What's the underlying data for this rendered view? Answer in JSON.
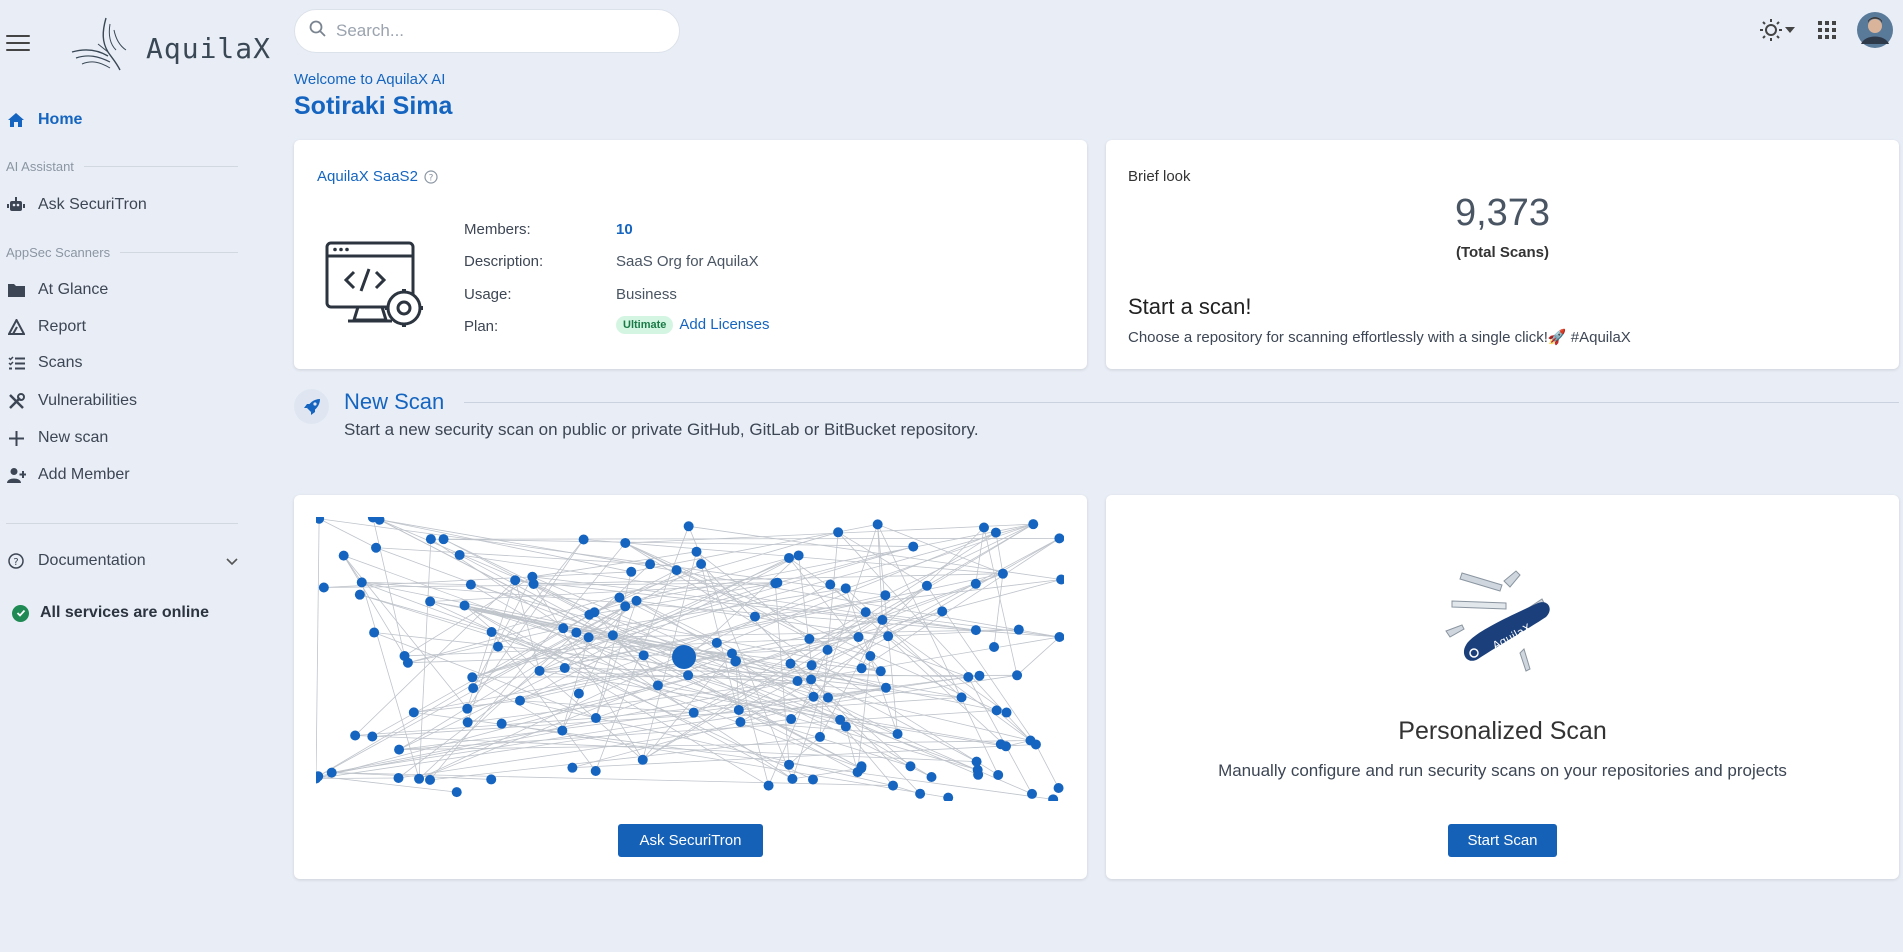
{
  "sidebar": {
    "logo_text": "AquilaX",
    "home": "Home",
    "section_ai": "AI Assistant",
    "ask": "Ask SecuriTron",
    "section_appsec": "AppSec Scanners",
    "items": [
      "At Glance",
      "Report",
      "Scans",
      "Vulnerabilities",
      "New scan",
      "Add Member"
    ],
    "documentation": "Documentation",
    "status": "All services are online"
  },
  "search": {
    "placeholder": "Search..."
  },
  "header": {
    "welcome": "Welcome to AquilaX AI",
    "user": "Sotiraki Sima"
  },
  "org": {
    "title": "AquilaX SaaS2",
    "members_label": "Members:",
    "members_value": "10",
    "description_label": "Description:",
    "description_value": "SaaS Org for AquilaX",
    "usage_label": "Usage:",
    "usage_value": "Business",
    "plan_label": "Plan:",
    "plan_badge": "Ultimate",
    "add_licenses": "Add Licenses"
  },
  "brief": {
    "title": "Brief look",
    "total": "9,373",
    "total_label": "(Total Scans)",
    "start_title": "Start a scan!",
    "start_sub": "Choose a repository for scanning effortlessly with a single click!🚀 #AquilaX"
  },
  "new_scan": {
    "title": "New Scan",
    "subtitle": "Start a new security scan on public or private GitHub, GitLab or BitBucket repository."
  },
  "ai_card": {
    "button": "Ask SecuriTron"
  },
  "personal": {
    "title": "Personalized Scan",
    "subtitle": "Manually configure and run security scans on your repositories and projects",
    "button": "Start Scan",
    "knife_text": "AquilaX"
  },
  "colors": {
    "accent": "#1565c0",
    "node": "#1565c0",
    "online": "#1f8a54"
  }
}
